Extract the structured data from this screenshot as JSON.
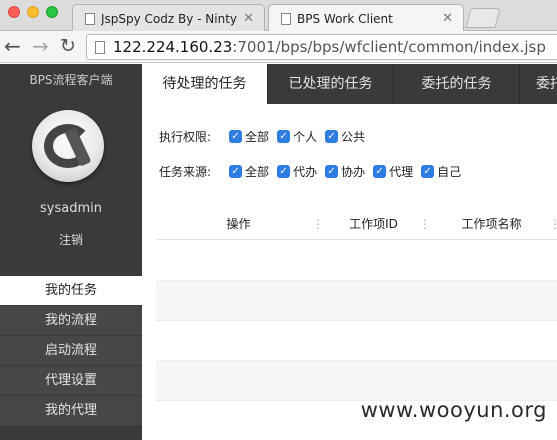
{
  "browser": {
    "tabs": [
      {
        "title": "JspSpy Codz By - Ninty",
        "active": false
      },
      {
        "title": "BPS Work Client",
        "active": true
      }
    ],
    "url_host": "122.224.160.23",
    "url_path": ":7001/bps/bps/wfclient/common/index.jsp"
  },
  "sidebar": {
    "app_name": "BPS流程客户端",
    "username": "sysadmin",
    "logout": "注销",
    "menu": [
      {
        "label": "我的任务",
        "active": true
      },
      {
        "label": "我的流程",
        "active": false
      },
      {
        "label": "启动流程",
        "active": false
      },
      {
        "label": "代理设置",
        "active": false
      },
      {
        "label": "我的代理",
        "active": false
      }
    ]
  },
  "main": {
    "tabs": [
      {
        "label": "待处理的任务",
        "active": true
      },
      {
        "label": "已处理的任务",
        "active": false
      },
      {
        "label": "委托的任务",
        "active": false
      },
      {
        "label": "委托",
        "active": false
      }
    ],
    "filters": {
      "permission_label": "执行权限:",
      "permission_options": [
        {
          "label": "全部",
          "checked": true
        },
        {
          "label": "个人",
          "checked": true
        },
        {
          "label": "公共",
          "checked": true
        }
      ],
      "source_label": "任务来源:",
      "source_options": [
        {
          "label": "全部",
          "checked": true
        },
        {
          "label": "代办",
          "checked": true
        },
        {
          "label": "协办",
          "checked": true
        },
        {
          "label": "代理",
          "checked": true
        },
        {
          "label": "自己",
          "checked": true
        }
      ]
    },
    "grid": {
      "columns": [
        "操作",
        "工作项ID",
        "工作项名称"
      ]
    }
  },
  "watermark": "www.wooyun.org",
  "colors": {
    "sidebar_bg": "#3a3a3a",
    "checkbox": "#2f7de1"
  }
}
